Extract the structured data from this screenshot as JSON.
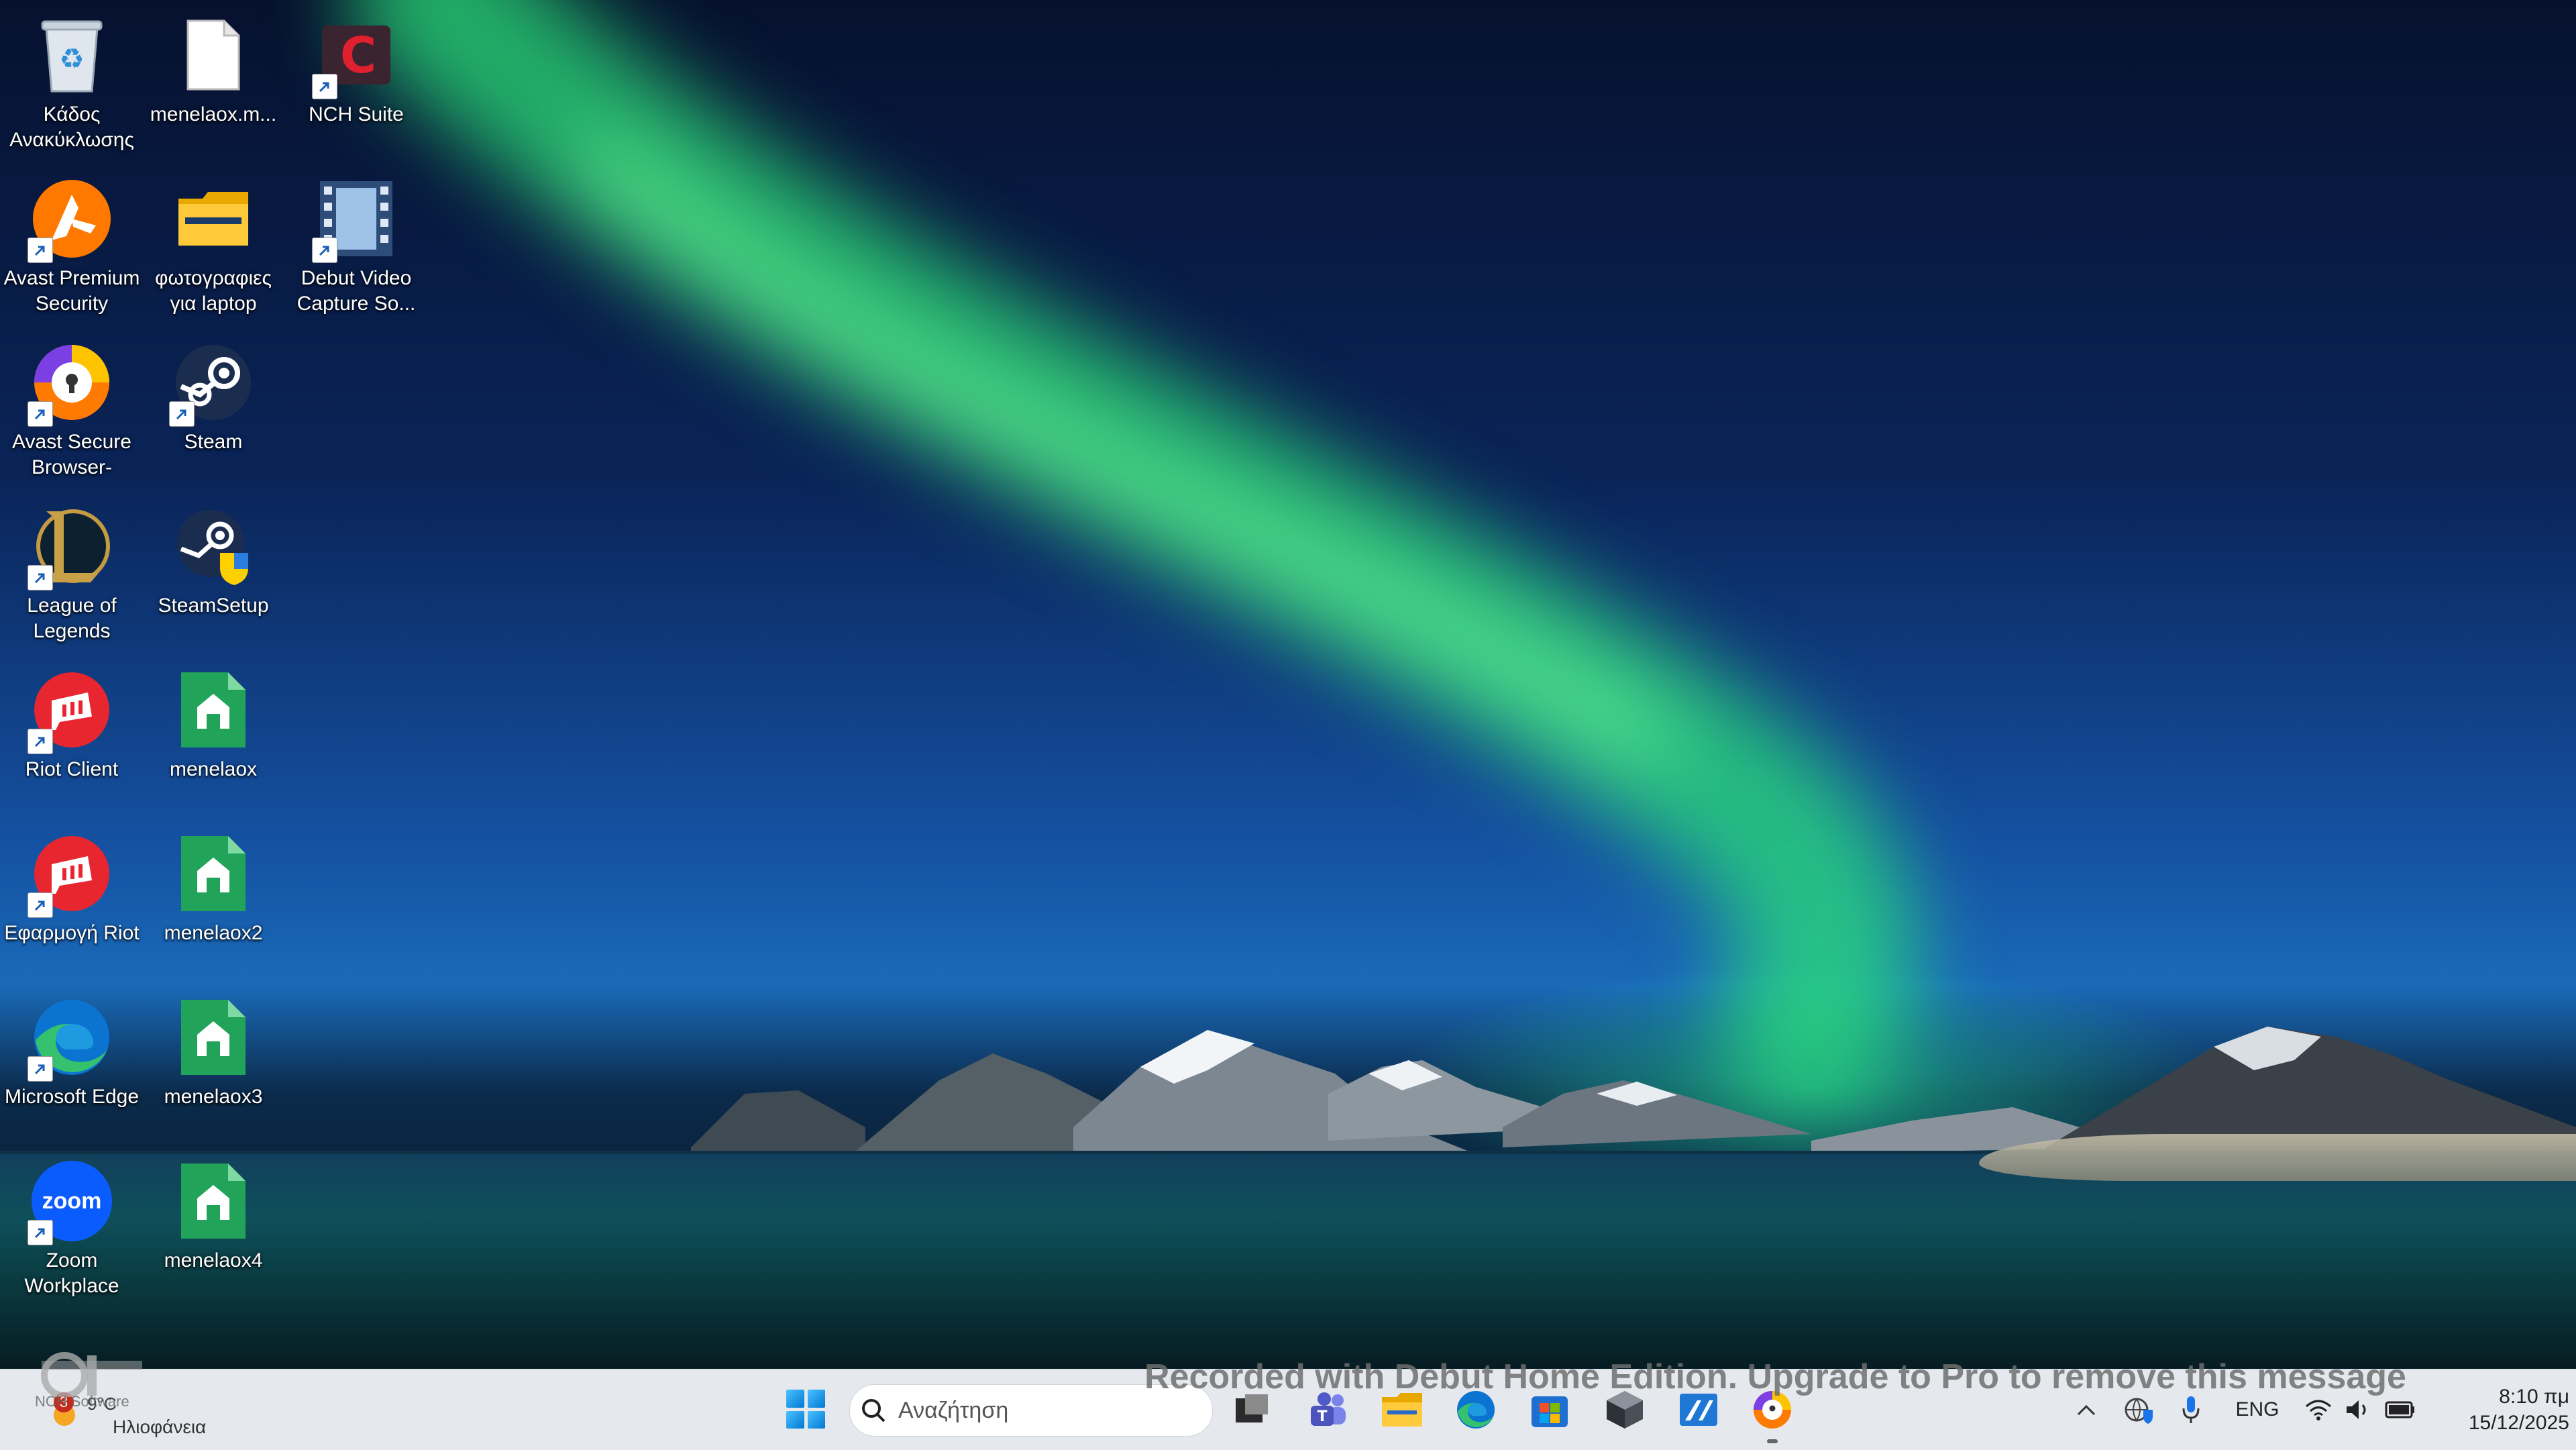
{
  "desktop": {
    "icons": [
      {
        "label": "Κάδος Ανακύκλωσης",
        "icon": "recycle-bin-icon"
      },
      {
        "label": "menelaox.m...",
        "icon": "file-icon"
      },
      {
        "label": "NCH Suite",
        "icon": "nch-suite-icon"
      },
      {
        "label": "Avast Premium Security",
        "icon": "avast-icon"
      },
      {
        "label": "φωτογραφιες για laptop",
        "icon": "folder-icon"
      },
      {
        "label": "Debut Video Capture So...",
        "icon": "debut-video-icon"
      },
      {
        "label": "Avast Secure Browser-",
        "icon": "avast-browser-icon"
      },
      {
        "label": "Steam",
        "icon": "steam-icon"
      },
      {
        "label": "League of Legends",
        "icon": "league-of-legends-icon"
      },
      {
        "label": "SteamSetup",
        "icon": "steam-setup-icon"
      },
      {
        "label": "Riot Client",
        "icon": "riot-client-icon"
      },
      {
        "label": "menelaox",
        "icon": "green-house-icon"
      },
      {
        "label": "Εφαρμογή Riot",
        "icon": "riot-app-icon"
      },
      {
        "label": "menelaox2",
        "icon": "green-house-icon"
      },
      {
        "label": "Microsoft Edge",
        "icon": "edge-icon"
      },
      {
        "label": "menelaox3",
        "icon": "green-house-icon"
      },
      {
        "label": "Zoom Workplace",
        "icon": "zoom-icon"
      },
      {
        "label": "menelaox4",
        "icon": "green-house-icon"
      }
    ],
    "zoom_text": "zoom"
  },
  "taskbar": {
    "weather": {
      "temp": "9°C",
      "condition": "Ηλιοφάνεια",
      "badge": "3",
      "overlay_text": "NCH Software"
    },
    "search": {
      "placeholder": "Αναζήτηση"
    },
    "apps": [
      "task-view-icon",
      "teams-icon",
      "file-explorer-icon",
      "edge-icon",
      "microsoft-store-icon",
      "app-cube-icon",
      "vscode-like-icon",
      "avast-browser-icon"
    ],
    "tray": {
      "language": "ENG"
    },
    "clock": {
      "time": "8:10 πμ",
      "date": "15/12/2025"
    }
  },
  "watermark": "Recorded with Debut Home Edition. Upgrade to Pro to remove this message",
  "colors": {
    "taskbar": "#eef0f5",
    "accent": "#0078d4",
    "green_app": "#1db954"
  }
}
